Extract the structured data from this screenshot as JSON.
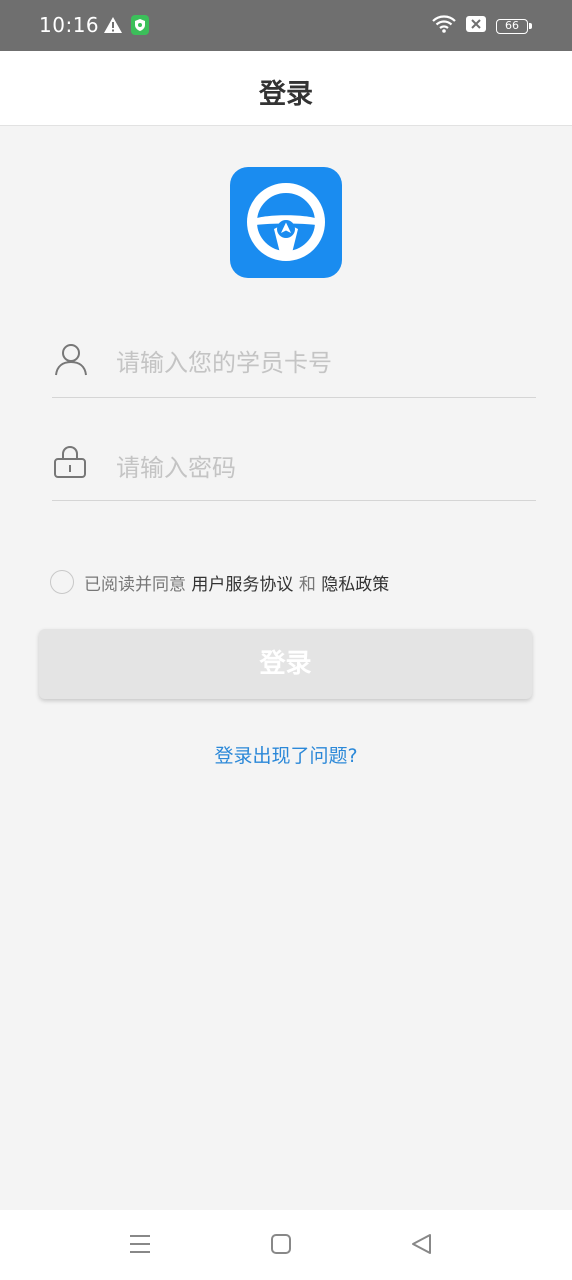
{
  "status_bar": {
    "time": "10:16",
    "battery_level": "66",
    "icons": [
      "warning-icon",
      "shield-icon",
      "wifi-icon",
      "no-sim-icon",
      "battery-icon"
    ]
  },
  "header": {
    "title": "登录"
  },
  "logo": {
    "icon": "steering-wheel-icon",
    "color": "#1a8cf0"
  },
  "form": {
    "card_placeholder": "请输入您的学员卡号",
    "password_placeholder": "请输入密码"
  },
  "agreement": {
    "prefix": "已阅读并同意",
    "terms_link": "用户服务协议",
    "conjunction": "和",
    "privacy_link": "隐私政策",
    "checked": false
  },
  "login_button": {
    "label": "登录"
  },
  "trouble_link": "登录出现了问题?",
  "nav_bar": {
    "icons": [
      "menu-icon",
      "home-icon",
      "back-icon"
    ]
  },
  "colors": {
    "accent": "#1a8cf0",
    "link": "#2b88d8",
    "background": "#f4f4f4",
    "status_bar": "#6f6f6f"
  }
}
